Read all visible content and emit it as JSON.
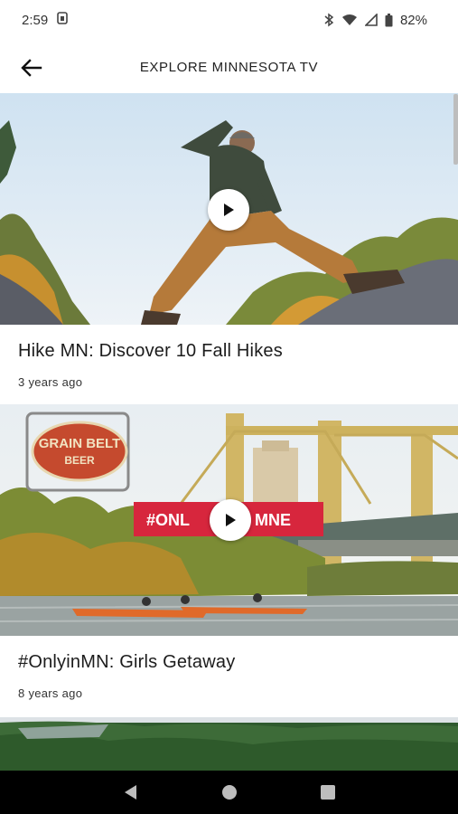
{
  "status_bar": {
    "time": "2:59",
    "battery_percent": "82%",
    "icons": [
      "notification-icon",
      "bluetooth-icon",
      "wifi-icon",
      "signal-icon",
      "battery-icon"
    ]
  },
  "app_bar": {
    "title": "EXPLORE MINNESOTA TV",
    "back_icon": "arrow-back-icon"
  },
  "videos": [
    {
      "title": "Hike MN: Discover 10 Fall Hikes",
      "age": "3 years ago",
      "play_icon": "play-icon"
    },
    {
      "title": "#OnlyinMN: Girls Getaway",
      "age": "8 years ago",
      "play_icon": "play-icon",
      "thumbnail_text": {
        "sign_line1": "GRAIN BELT",
        "sign_line2": "BEER",
        "banner_left": "#ONL",
        "banner_right": "MNE"
      }
    }
  ],
  "nav_bar": {
    "icons": [
      "back-triangle-icon",
      "home-circle-icon",
      "recents-square-icon"
    ]
  },
  "colors": {
    "banner_red": "#d7263d",
    "nav_bg": "#000000"
  }
}
